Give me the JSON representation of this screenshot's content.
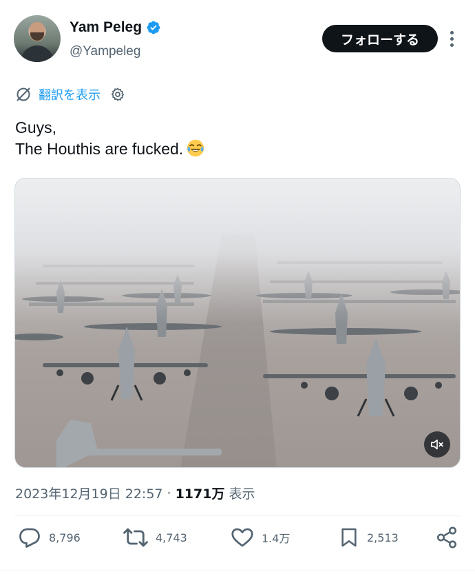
{
  "author": {
    "display_name": "Yam Peleg",
    "handle": "@Yampeleg",
    "verified": true,
    "avatar_icon": "profile-photo"
  },
  "header": {
    "follow_label": "フォローする",
    "more_icon": "more-horizontal-icon"
  },
  "translate": {
    "label": "翻訳を表示",
    "icon": "translate-icon",
    "settings_icon": "gear-icon"
  },
  "tweet": {
    "text_line1": "Guys,",
    "text_line2": "The Houthis are fucked.",
    "emoji": "😂"
  },
  "media": {
    "type": "video",
    "mute_icon": "volume-muted-icon"
  },
  "meta": {
    "timestamp": "2023年12月19日 22:57",
    "separator": "·",
    "views_count": "1171万",
    "views_label": "表示"
  },
  "actions": {
    "replies": "8,796",
    "retweets": "4,743",
    "likes": "1.4万",
    "bookmarks": "2,513"
  },
  "colors": {
    "accent": "#1d9bf0",
    "text": "#0f1419",
    "secondary": "#536471",
    "button_bg": "#0f1419"
  }
}
